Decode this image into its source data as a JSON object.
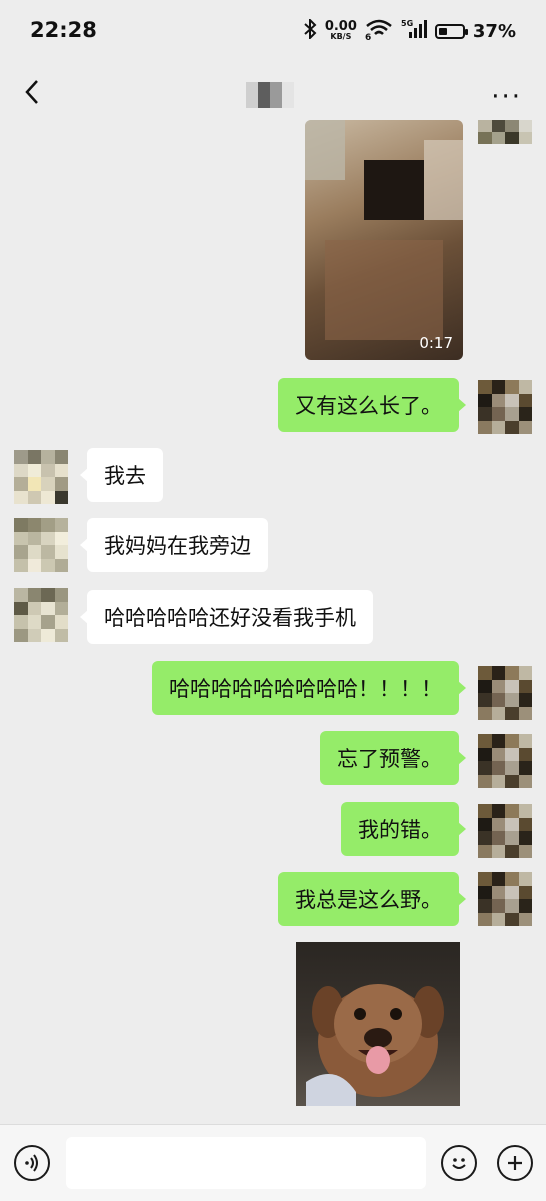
{
  "status_bar": {
    "time": "22:28",
    "net_speed": "0.00",
    "net_unit": "KB/S",
    "battery": "37%",
    "battery_level": 0.37,
    "signal": "5G",
    "wifi_label": "6"
  },
  "header": {
    "back_icon": "chevron-left-icon",
    "more_icon": "more-dots-icon",
    "more_label": "···"
  },
  "video": {
    "duration": "0:17"
  },
  "messages": [
    {
      "side": "out",
      "text": "又有这么长了。"
    },
    {
      "side": "in",
      "text": "我去"
    },
    {
      "side": "in",
      "text": "我妈妈在我旁边"
    },
    {
      "side": "in",
      "text": "哈哈哈哈哈还好没看我手机"
    },
    {
      "side": "out",
      "text": "哈哈哈哈哈哈哈哈哈！！！！"
    },
    {
      "side": "out",
      "text": "忘了预警。"
    },
    {
      "side": "out",
      "text": "我的错。"
    },
    {
      "side": "out",
      "text": "我总是这么野。"
    }
  ],
  "bottom_bar": {
    "voice_icon": "voice-icon",
    "emoji_icon": "emoji-icon",
    "plus_icon": "plus-icon"
  }
}
